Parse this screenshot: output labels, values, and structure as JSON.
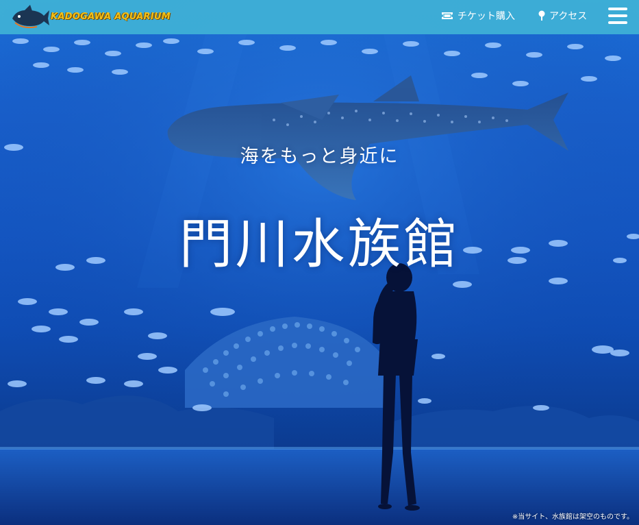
{
  "header": {
    "logo_text": "KADOGAWA AQUARIUM",
    "nav": [
      {
        "label": "チケット購入",
        "icon": "ticket-icon"
      },
      {
        "label": "アクセス",
        "icon": "map-pin-icon"
      }
    ],
    "menu_icon": "hamburger-menu-icon"
  },
  "hero": {
    "tagline": "海をもっと身近に",
    "title": "門川水族館",
    "disclaimer": "※当サイト、水族館は架空のものです。",
    "image": "aquarium-tank-photo",
    "colors": {
      "header_bg": "#40b2d6",
      "water": "#1456c2",
      "logo_text": "#f2c21a"
    }
  }
}
